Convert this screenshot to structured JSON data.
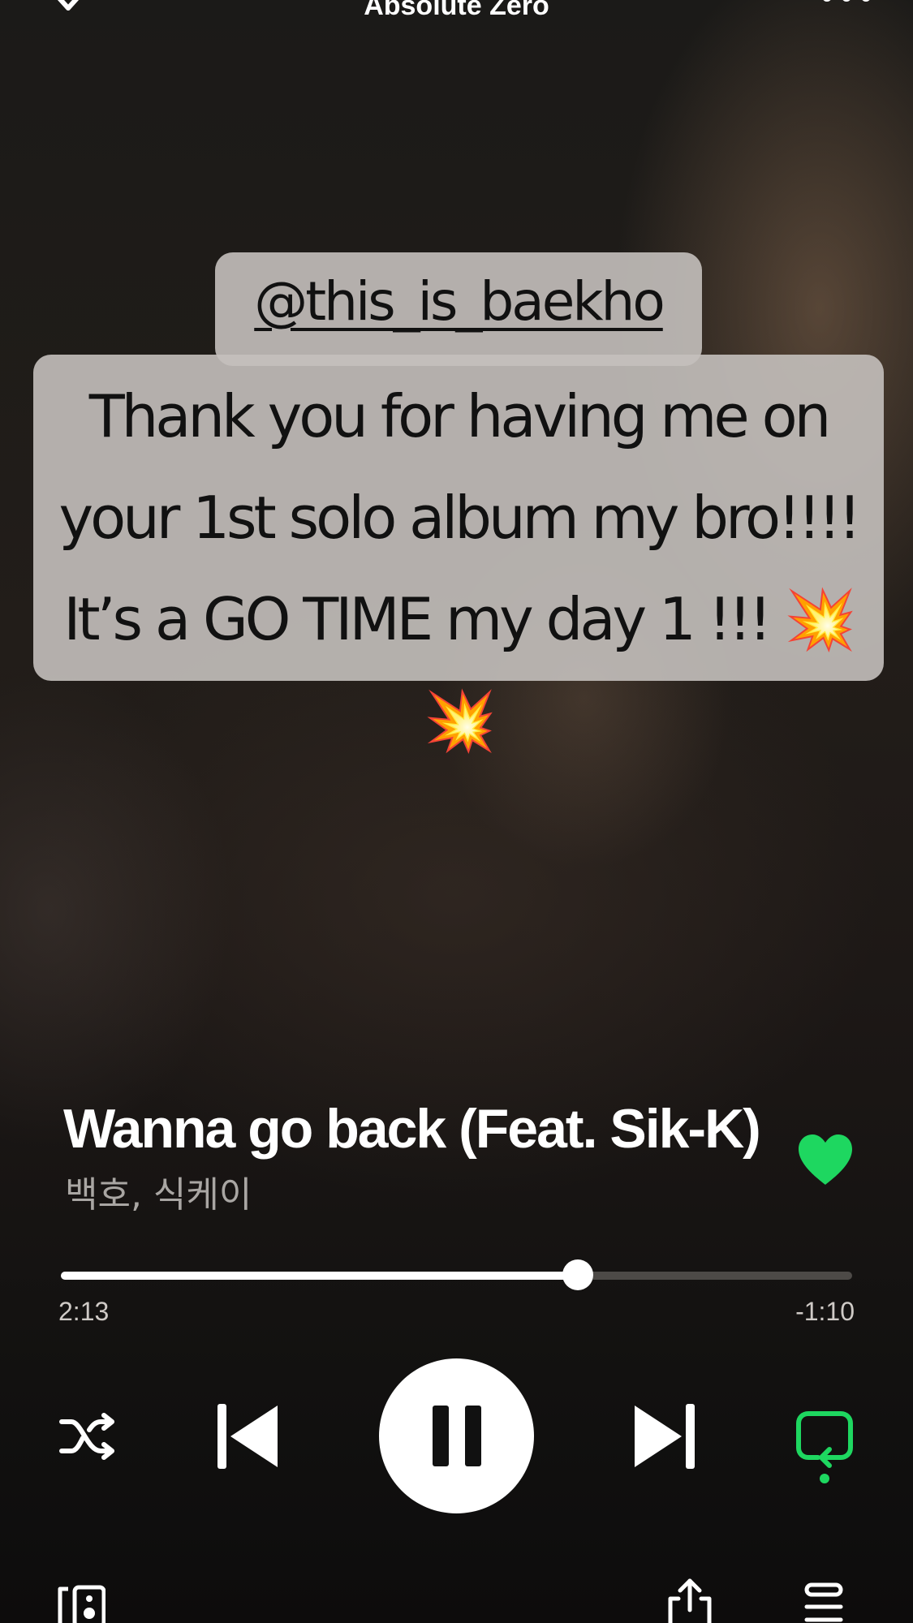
{
  "header": {
    "album_title": "Absolute Zero",
    "collapse_icon": "chevron-down-icon",
    "more_icon": "more-horizontal-icon"
  },
  "story": {
    "mention": "@this_is_baekho",
    "message": "Thank you for having me on\nyour 1st solo album my bro!!!!\nIt’s a GO TIME my day 1 !!! 💥💥"
  },
  "track": {
    "title": "Wanna go back (Feat. Sik-K)",
    "artists": "백호, 식케이",
    "liked": true
  },
  "playback": {
    "elapsed": "2:13",
    "remaining": "-1:10",
    "progress_fraction": 0.653,
    "state": "playing"
  },
  "controls": {
    "shuffle_icon": "shuffle-icon",
    "previous_icon": "skip-previous-icon",
    "pause_icon": "pause-icon",
    "next_icon": "skip-next-icon",
    "repeat_icon": "repeat-icon",
    "repeat_active": true
  },
  "footer": {
    "devices_icon": "connect-device-icon",
    "share_icon": "share-icon",
    "queue_icon": "queue-icon"
  },
  "colors": {
    "accent": "#1ed760",
    "text_primary": "#ffffff",
    "text_secondary": "#a9a6a3",
    "sticker_bg": "#c4c0bc"
  }
}
